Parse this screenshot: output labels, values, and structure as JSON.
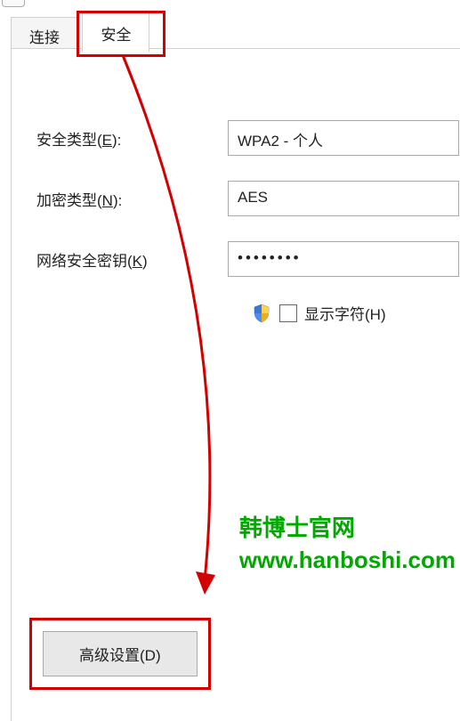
{
  "tabs": {
    "connect": "连接",
    "security": "安全"
  },
  "labels": {
    "security_type_pre": "安全类型(",
    "security_type_key": "E",
    "security_type_post": "):",
    "encryption_type_pre": "加密类型(",
    "encryption_type_key": "N",
    "encryption_type_post": "):",
    "network_key_pre": "网络安全密钥(",
    "network_key_key": "K",
    "network_key_post": ")",
    "show_chars_pre": "显示字符(",
    "show_chars_key": "H",
    "show_chars_post": ")"
  },
  "values": {
    "security_type": "WPA2 - 个人",
    "encryption_type": "AES",
    "password_mask": "••••••••"
  },
  "button": {
    "advanced_pre": "高级设置(",
    "advanced_key": "D",
    "advanced_post": ")"
  },
  "watermark": {
    "line1": "韩博士官网",
    "line2": "www.hanboshi.com"
  },
  "colors": {
    "highlight": "#d40000",
    "watermark": "#00a800"
  }
}
